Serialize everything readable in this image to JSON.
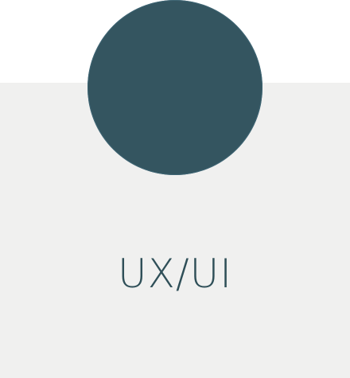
{
  "card": {
    "title": "UX/UI"
  },
  "colors": {
    "circle_fill": "#345560",
    "panel_background": "#f0f0ef",
    "title_text": "#2f4f58",
    "page_background": "#ffffff"
  }
}
